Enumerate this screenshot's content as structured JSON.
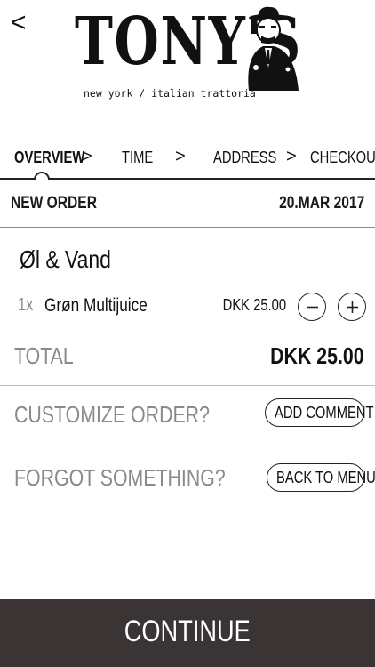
{
  "header": {
    "back_label": "<",
    "logo_name": "TONY'S",
    "logo_tagline": "new york / italian trattoria"
  },
  "steps": [
    {
      "label": "OVERVIEW",
      "active": true
    },
    {
      "label": "TIME",
      "active": false
    },
    {
      "label": "ADDRESS",
      "active": false
    },
    {
      "label": "CHECKOUT",
      "active": false
    }
  ],
  "step_separator": ">",
  "order": {
    "label": "NEW ORDER",
    "date": "20.MAR 2017"
  },
  "category": "Øl & Vand",
  "items": [
    {
      "qty": "1x",
      "name": "Grøn Multijuice",
      "price": "DKK 25.00"
    }
  ],
  "total": {
    "label": "TOTAL",
    "value": "DKK 25.00"
  },
  "customize": {
    "label": "CUSTOMIZE ORDER?",
    "button": "ADD COMMENT"
  },
  "forgot": {
    "label": "FORGOT SOMETHING?",
    "button": "BACK TO MENU"
  },
  "continue_label": "CONTINUE",
  "colors": {
    "continue_bg": "#3a3534",
    "muted_text": "#8a8a8a",
    "dark_text": "#111111"
  }
}
